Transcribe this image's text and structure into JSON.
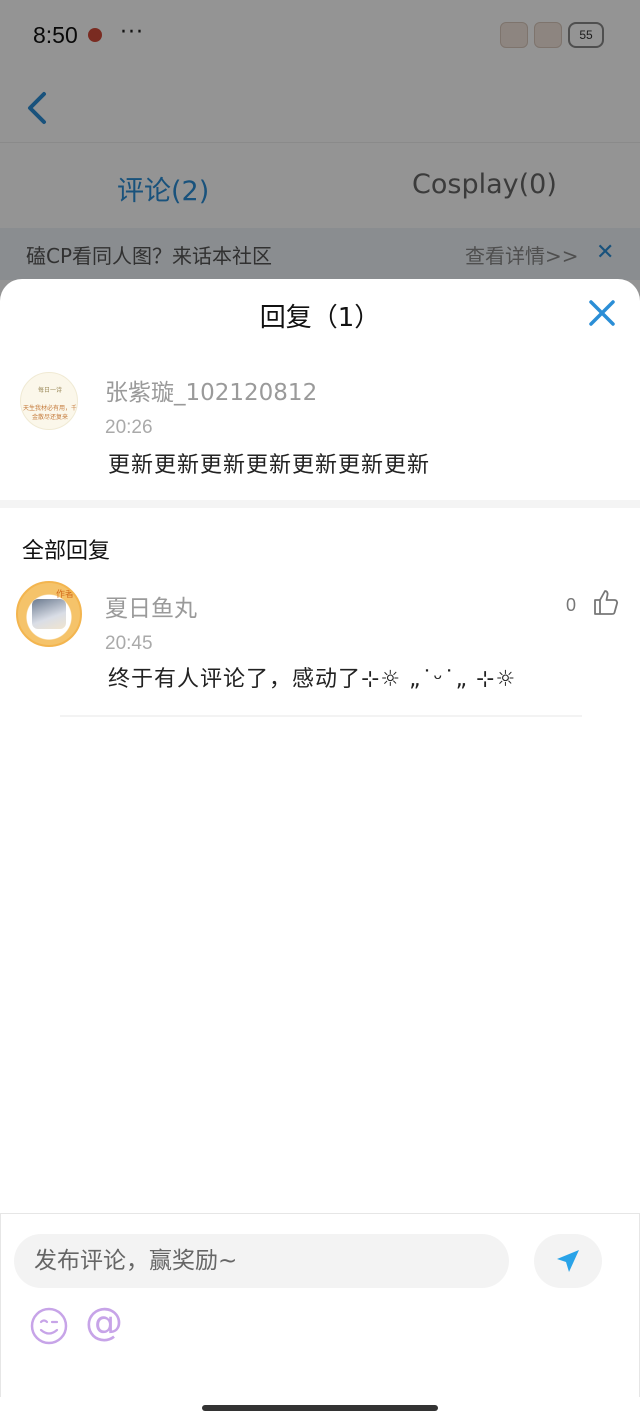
{
  "status_bar": {
    "time": "8:50",
    "dots": "···",
    "battery": "55"
  },
  "nav": {
    "back_icon": "chevron-left-icon"
  },
  "tabs": [
    {
      "label": "评论(2)",
      "active": true
    },
    {
      "label": "Cosplay(0)",
      "active": false
    }
  ],
  "promo": {
    "text": "磕CP看同人图？来话本社区",
    "link": "查看详情>>",
    "close": "✕"
  },
  "sheet": {
    "title": "回复（1）",
    "close_icon": "close-icon"
  },
  "original_comment": {
    "username": "张紫璇_102120812",
    "time": "20:26",
    "content": "更新更新更新更新更新更新更新",
    "avatar_text_1": "每日一诗",
    "avatar_text_2": "天生我材必有用，千金散尽还复来"
  },
  "section": {
    "title": "全部回复"
  },
  "replies": [
    {
      "username": "夏日鱼丸",
      "time": "20:45",
      "content": "终于有人评论了，感动了⊹☼ „˙ᵕ˙„ ⊹☼",
      "likes": "0",
      "avatar_tag": "作者"
    }
  ],
  "bottom_bar": {
    "input_placeholder": "发布评论，赢奖励~",
    "send_icon": "send-icon",
    "emoji_icon": "emoji-icon",
    "at_symbol": "@"
  },
  "colors": {
    "accent": "#2b8ed6",
    "send": "#29a3e8",
    "emoji": "#c7a4e8"
  }
}
